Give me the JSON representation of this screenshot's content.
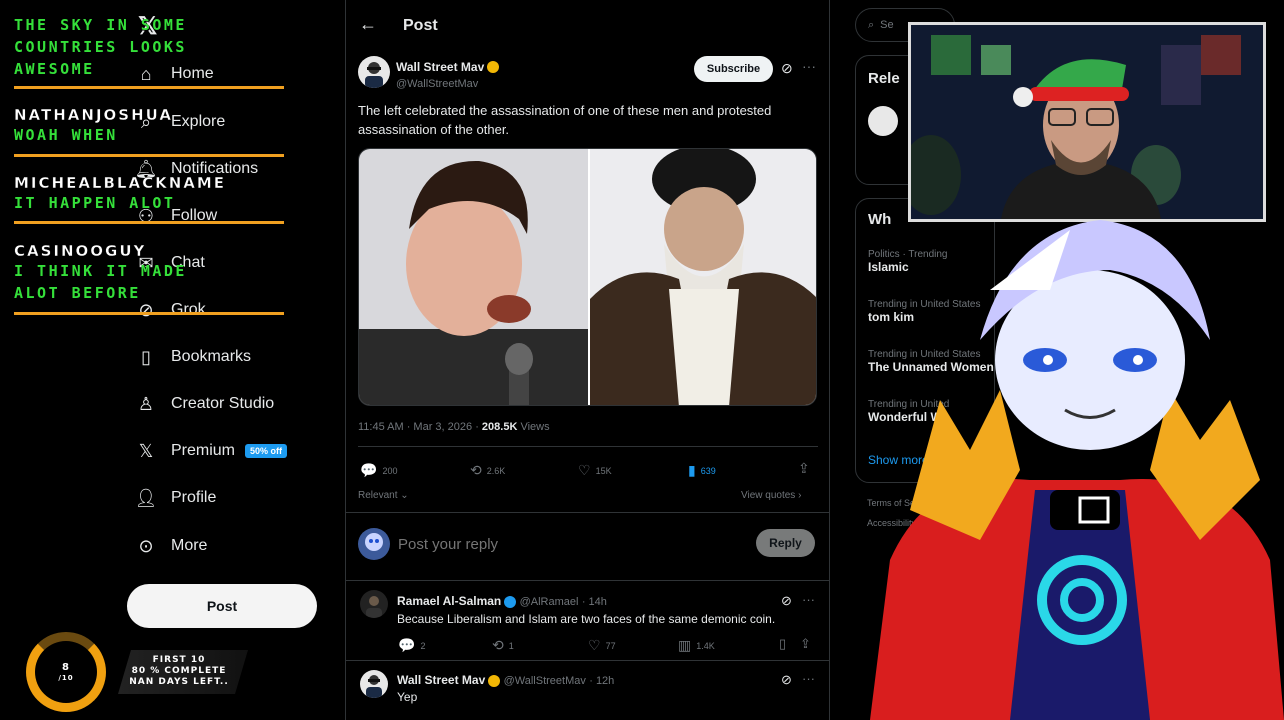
{
  "chat_overlay": {
    "messages": [
      {
        "name": "",
        "text_lines": [
          "THE SKY IN SOME",
          "COUNTRIES LOOKS",
          "AWESOME"
        ]
      },
      {
        "name": "NATHANJOSHUA",
        "text_lines": [
          "WOAH WHEN"
        ]
      },
      {
        "name": "MICHEALBLACKNAME",
        "text_lines": [
          "IT HAPPEN ALOT"
        ]
      },
      {
        "name": "CASINOOGUY",
        "text_lines": [
          "I THINK IT MADE",
          "ALOT BEFORE"
        ]
      }
    ]
  },
  "nav": {
    "items": [
      {
        "label": "Home",
        "icon": "home-icon"
      },
      {
        "label": "Explore",
        "icon": "search-icon"
      },
      {
        "label": "Notifications",
        "icon": "bell-icon"
      },
      {
        "label": "Follow",
        "icon": "follow-icon"
      },
      {
        "label": "Chat",
        "icon": "chat-icon"
      },
      {
        "label": "Grok",
        "icon": "grok-icon"
      },
      {
        "label": "Bookmarks",
        "icon": "bookmark-icon"
      },
      {
        "label": "Creator Studio",
        "icon": "creator-icon"
      },
      {
        "label": "Premium",
        "icon": "x-logo-icon",
        "badge": "50% off"
      },
      {
        "label": "Profile",
        "icon": "person-icon"
      },
      {
        "label": "More",
        "icon": "more-circle-icon"
      }
    ],
    "post_button": "Post"
  },
  "header": {
    "back": "←",
    "title": "Post"
  },
  "tweet": {
    "author": "Wall Street Mav",
    "handle": "@WallStreetMav",
    "subscribe_label": "Subscribe",
    "text": "The left celebrated the assassination of one of these men and protested assassination of the other.",
    "time": "11:45 AM · Mar 3, 2026 ·",
    "views_count": "208.5K",
    "views_label": "Views",
    "replies": "200",
    "reposts": "2.6K",
    "likes": "15K",
    "bookmarks": "639",
    "sort_label": "Relevant",
    "view_quotes": "View quotes"
  },
  "reply_box": {
    "placeholder": "Post your reply",
    "button": "Reply"
  },
  "replies": [
    {
      "author": "Ramael Al-Salman",
      "handle": "@AlRamael",
      "time": "· 14h",
      "text": "Because Liberalism and Islam are two faces of the same demonic coin.",
      "replies": "2",
      "reposts": "1",
      "likes": "77",
      "views": "1.4K"
    },
    {
      "author": "Wall Street Mav",
      "handle": "@WallStreetMav",
      "time": "· 12h",
      "text": "Yep"
    }
  ],
  "right_sidebar": {
    "search_placeholder": "Se",
    "relevant_title": "Rele",
    "whats_title": "Wh",
    "trends": [
      {
        "category": "Politics · Trending",
        "name": "Islamic"
      },
      {
        "category": "Trending in United States",
        "name": "tom kim"
      },
      {
        "category": "Trending in United States",
        "name": "The Unnamed Women"
      },
      {
        "category": "Trending in United",
        "name": "Wonderful W"
      }
    ],
    "show_more": "Show more",
    "footer_1": "Terms of Service",
    "footer_2": "Accessibility"
  },
  "progress_widget": {
    "ring_value": "8",
    "ring_total": "/10",
    "line1": "FIRST 10",
    "line2": "80 % COMPLETE",
    "line3": "NAN DAYS LEFT.."
  },
  "colors": {
    "accent_blue": "#1d9bf0",
    "chat_green": "#35e03a",
    "chat_orange": "#f0a020",
    "verified_gold": "#f2b705"
  }
}
